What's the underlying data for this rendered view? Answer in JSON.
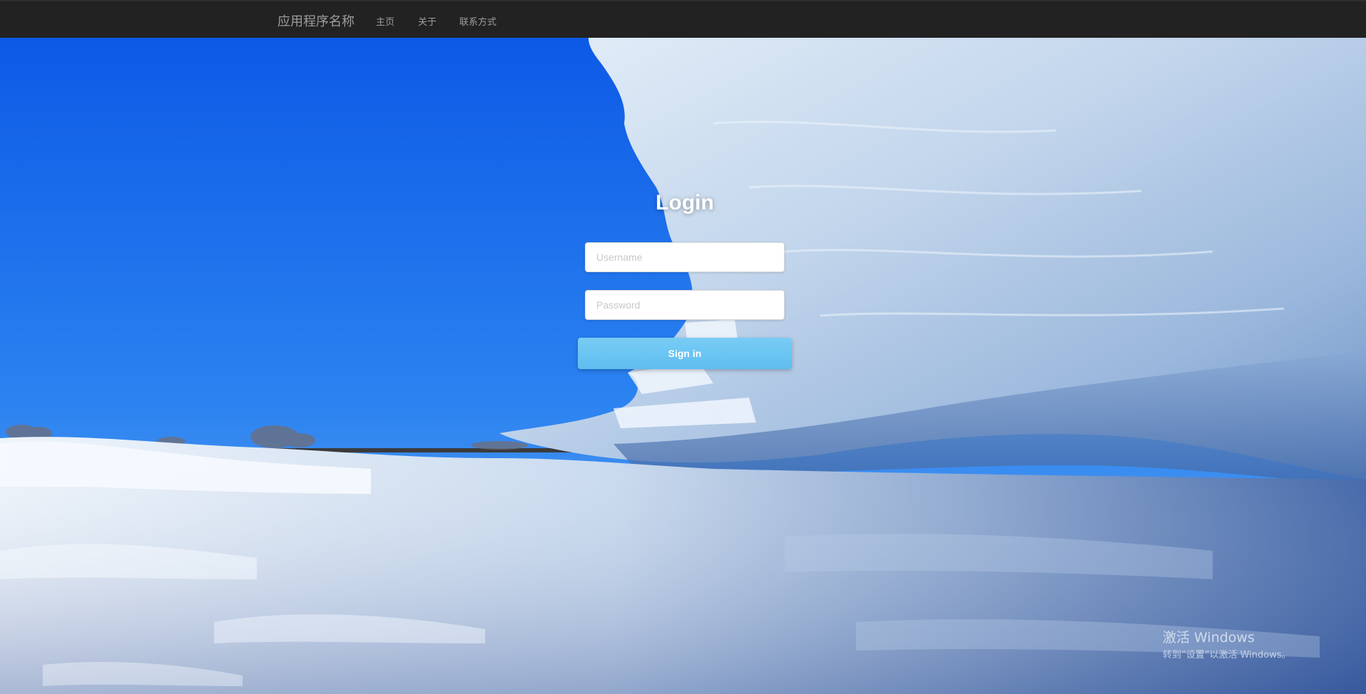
{
  "navbar": {
    "brand": "应用程序名称",
    "links": [
      {
        "label": "主页"
      },
      {
        "label": "关于"
      },
      {
        "label": "联系方式"
      }
    ]
  },
  "login": {
    "title": "Login",
    "username_placeholder": "Username",
    "password_placeholder": "Password",
    "signin_label": "Sign in"
  },
  "watermark": {
    "title": "激活 Windows",
    "subtitle": "转到“设置”以激活 Windows。"
  },
  "colors": {
    "navbar_bg": "#222222",
    "nav_text": "#9d9d9d",
    "sky": "#1e6ae0",
    "signin_button": "#6cc5f2",
    "title_text": "#ffffff"
  },
  "icons": []
}
